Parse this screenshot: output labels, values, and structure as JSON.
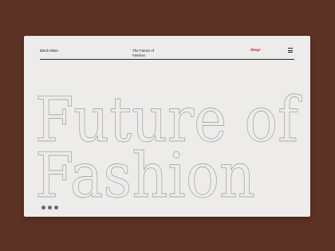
{
  "header": {
    "brand": "Black Milan",
    "page_title": "The Future of Fashion",
    "shop_label": "Shop",
    "shop_badge": "●"
  },
  "hero": {
    "line1": "Future of",
    "line2": "Fashion"
  },
  "social": {
    "items": [
      "circle-icon",
      "circle-icon",
      "circle-icon"
    ]
  },
  "colors": {
    "background": "#5b3224",
    "card": "#edecea",
    "accent": "#c0143c",
    "outline": "#9a9a9a"
  }
}
